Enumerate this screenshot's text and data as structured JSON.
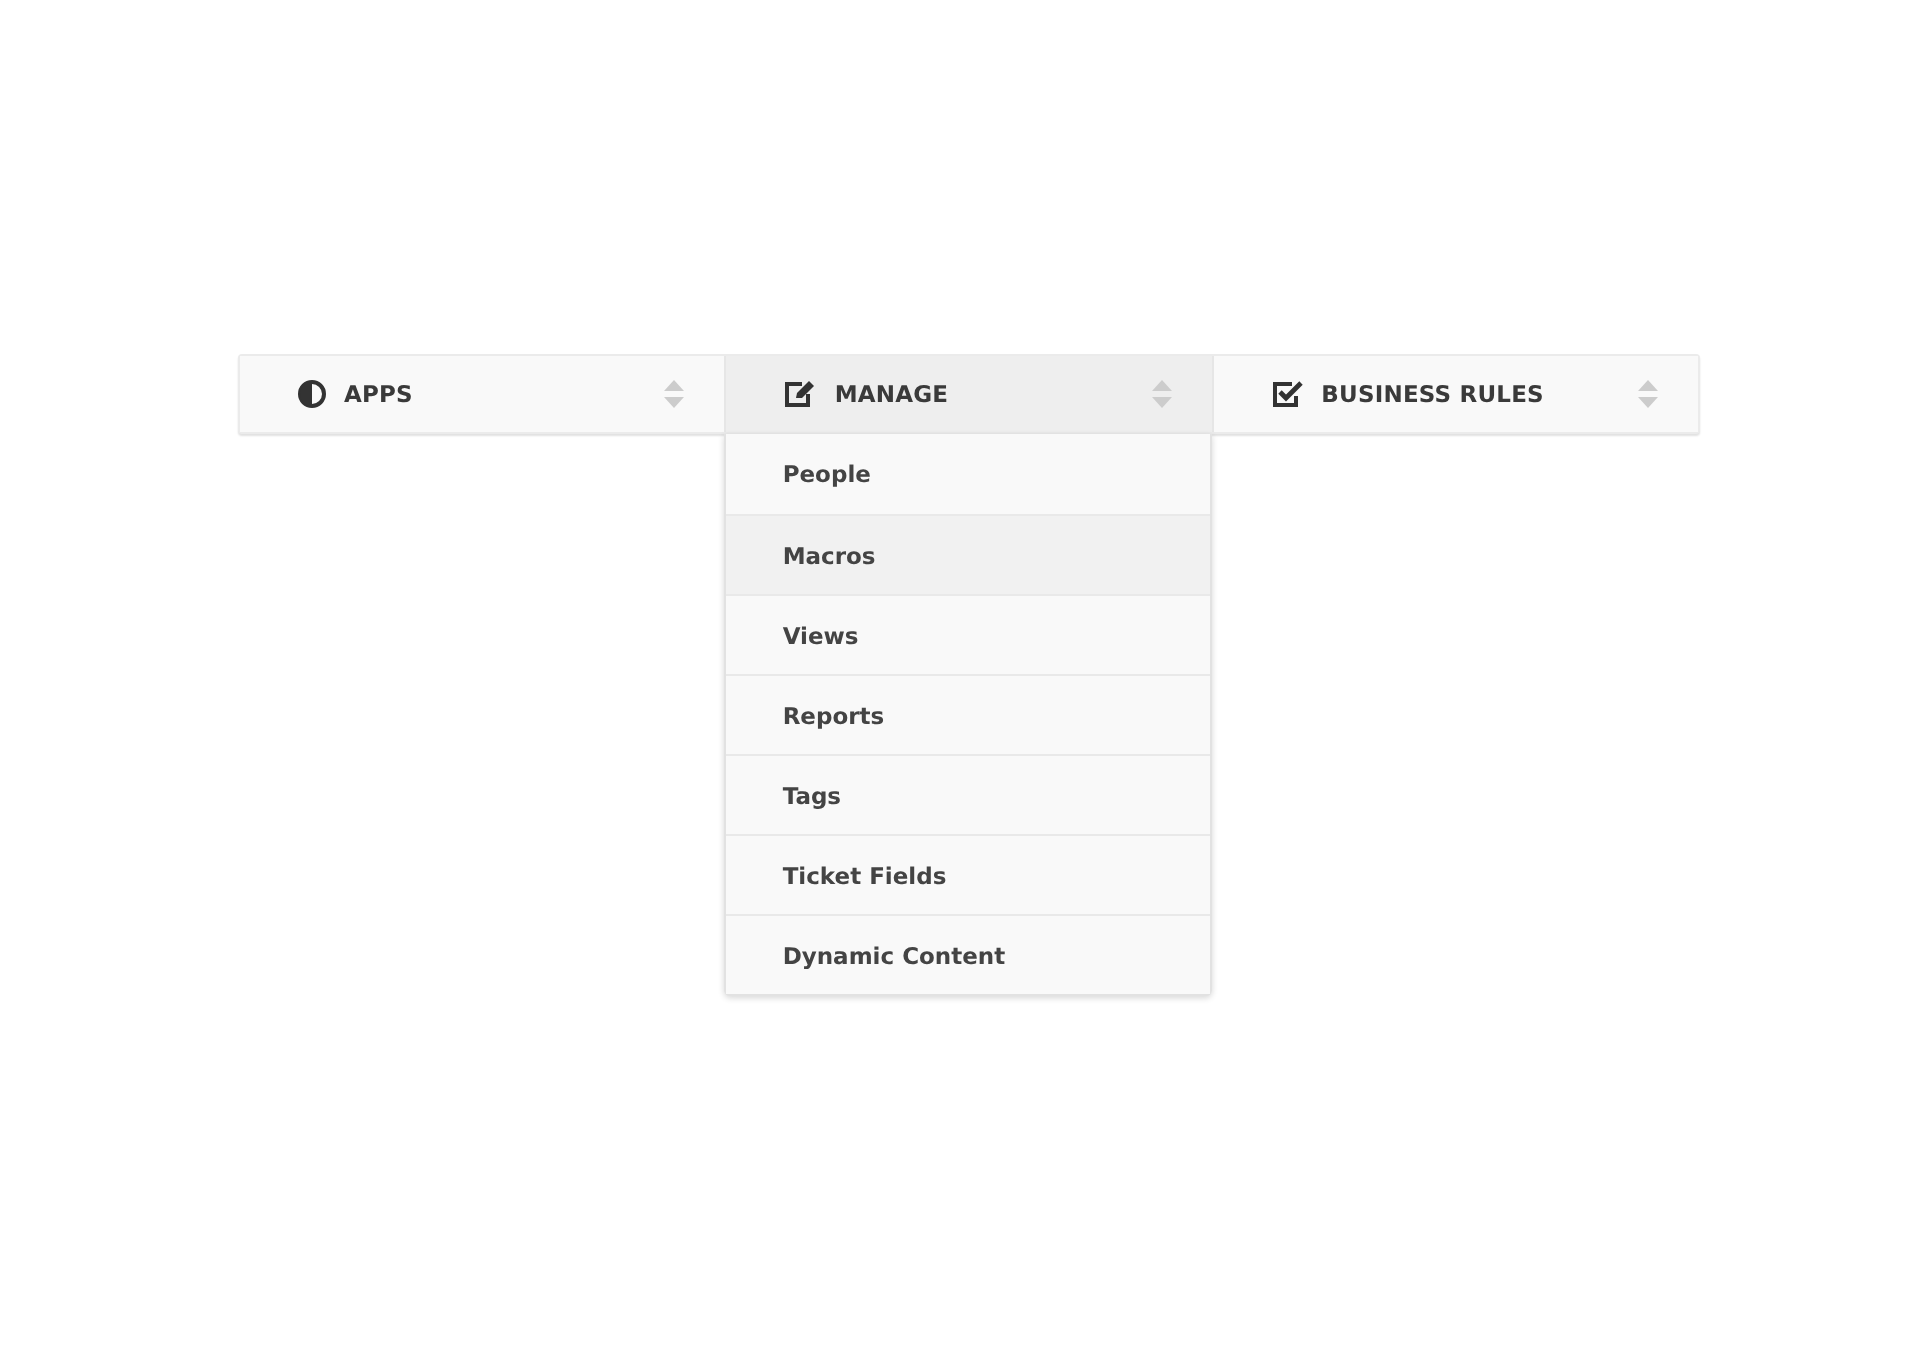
{
  "menu_bar": {
    "menus": [
      {
        "label": "APPS",
        "expanded": false
      },
      {
        "label": "MANAGE",
        "expanded": true,
        "items": [
          {
            "label": "People",
            "selected": false
          },
          {
            "label": "Macros",
            "selected": true
          },
          {
            "label": "Views",
            "selected": false
          },
          {
            "label": "Reports",
            "selected": false
          },
          {
            "label": "Tags",
            "selected": false
          },
          {
            "label": "Ticket Fields",
            "selected": false
          },
          {
            "label": "Dynamic Content",
            "selected": false
          }
        ]
      },
      {
        "label": "BUSINESS RULES",
        "expanded": false
      }
    ]
  }
}
